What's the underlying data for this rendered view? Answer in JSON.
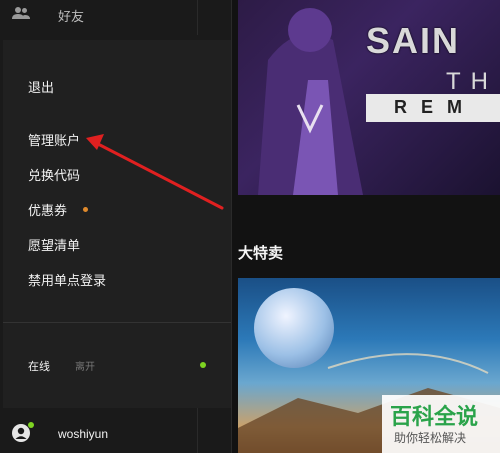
{
  "sidebar": {
    "friends_label": "好友",
    "menu": {
      "logout": "退出",
      "manage_account": "管理账户",
      "redeem_code": "兑换代码",
      "coupons": "优惠券",
      "wishlist": "愿望清单",
      "disable_sso": "禁用单点登录"
    },
    "status": {
      "online": "在线",
      "away": "离开"
    },
    "username": "woshiyun"
  },
  "main": {
    "hero": {
      "title": "SAIN",
      "subtitle": "TH",
      "bar_text": "REM"
    },
    "section_title": "大特卖"
  },
  "watermark": {
    "brand": "百科全说",
    "slogan": "助你轻松解决"
  },
  "colors": {
    "online": "#7ed321",
    "coupon_dot": "#e08a2c",
    "arrow": "#e02020"
  }
}
